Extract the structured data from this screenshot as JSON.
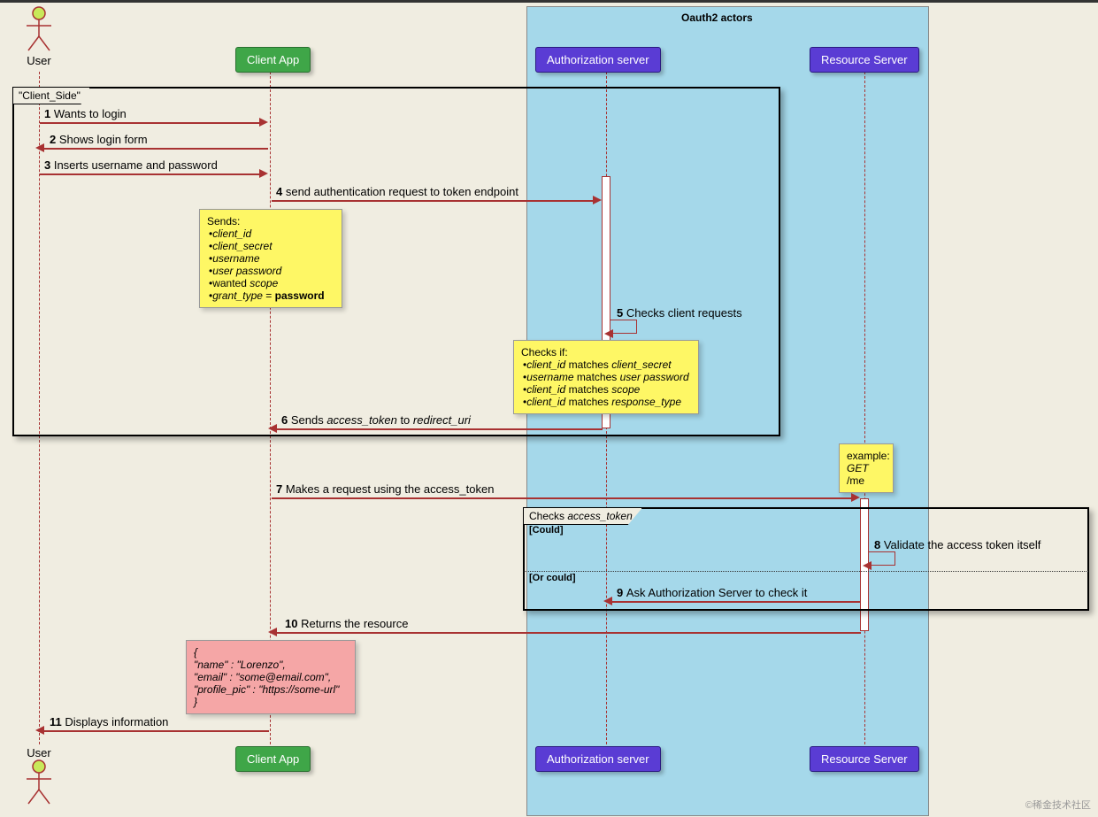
{
  "oauth_box_title": "Oauth2 actors",
  "actors": {
    "user_top": "User",
    "user_bottom": "User"
  },
  "participants": {
    "client_app_top": "Client App",
    "auth_server_top": "Authorization server",
    "resource_server_top": "Resource Server",
    "client_app_bottom": "Client App",
    "auth_server_bottom": "Authorization server",
    "resource_server_bottom": "Resource Server"
  },
  "frames": {
    "client_side": "\"Client_Side\"",
    "checks_token_prefix": "Checks ",
    "checks_token_em": "access_token"
  },
  "guards": {
    "could": "[Could]",
    "or_could": "[Or could]"
  },
  "messages": {
    "m1_num": "1 ",
    "m1_text": "Wants to login",
    "m2_num": "2 ",
    "m2_text": "Shows login form",
    "m3_num": "3 ",
    "m3_text": "Inserts username and password",
    "m4_num": "4 ",
    "m4_text": "send authentication request to token endpoint",
    "m5_num": "5 ",
    "m5_text": "Checks client requests",
    "m6_num": "6 ",
    "m6_pre": "Sends ",
    "m6_em1": "access_token",
    "m6_mid": " to ",
    "m6_em2": "redirect_uri",
    "m7_num": "7 ",
    "m7_text": "Makes a request using the access_token",
    "m8_num": "8 ",
    "m8_text": "Validate the access token itself",
    "m9_num": "9 ",
    "m9_text": "Ask Authorization Server to check it",
    "m10_num": "10 ",
    "m10_text": "Returns the resource",
    "m11_num": "11 ",
    "m11_text": "Displays information"
  },
  "note_sends": {
    "title": "Sends:",
    "i1": "client_id",
    "i2": "client_secret",
    "i3": "username",
    "i4": "user password",
    "i5_pre": "wanted ",
    "i5_em": "scope",
    "i6_em": "grant_type",
    "i6_mid": " = ",
    "i6_b": "password"
  },
  "note_checks": {
    "title": "Checks if:",
    "l1_a": "client_id",
    "l1_m": " matches ",
    "l1_b": "client_secret",
    "l2_a": "username",
    "l2_m": " matches ",
    "l2_b": "user password",
    "l3_a": "client_id",
    "l3_m": " matches ",
    "l3_b": "scope",
    "l4_a": "client_id",
    "l4_m": " matches ",
    "l4_b": "response_type"
  },
  "note_example": {
    "l1": "example:",
    "l2_em": "GET",
    "l2_rest": " /me"
  },
  "note_response": {
    "l1": "{",
    "l2": "\"name\" : \"Lorenzo\",",
    "l3": "\"email\" : \"some@email.com\",",
    "l4": "\"profile_pic\" : \"https://some-url\"",
    "l5": "}"
  },
  "watermark": "©稀金技术社区"
}
